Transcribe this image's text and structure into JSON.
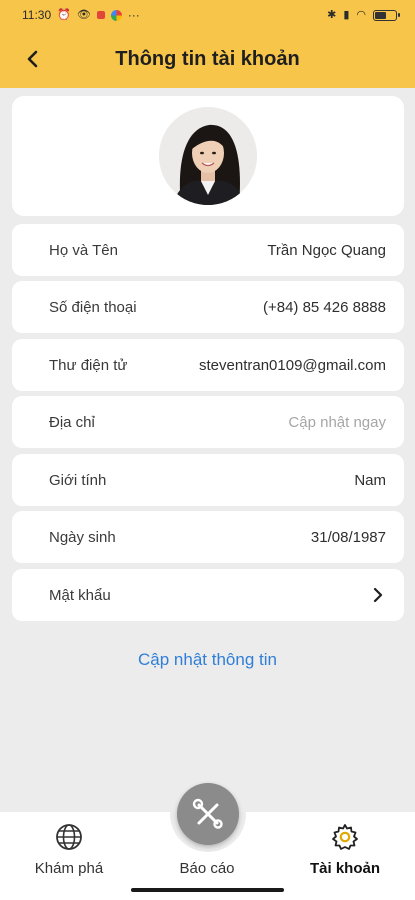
{
  "status_bar": {
    "time": "11:30",
    "dots": "···",
    "battery_level": 0.6
  },
  "header": {
    "title": "Thông tin tài khoản",
    "back_icon": "arrow-left-icon"
  },
  "profile": {
    "avatar_icon": "user-photo"
  },
  "rows": {
    "full_name": {
      "label": "Họ và Tên",
      "value": "Trần Ngọc Quang"
    },
    "phone": {
      "label": "Số điện thoại",
      "value": "(+84) 85 426 8888"
    },
    "email": {
      "label": "Thư điện tử",
      "value": "steventran0109@gmail.com"
    },
    "address": {
      "label": "Địa chỉ",
      "value": "Cập nhật ngay"
    },
    "gender": {
      "label": "Giới tính",
      "value": "Nam"
    },
    "birthday": {
      "label": "Ngày sinh",
      "value": "31/08/1987"
    },
    "password": {
      "label": "Mật khẩu"
    }
  },
  "update_link": "Cập nhật thông tin",
  "nav": {
    "explore": {
      "label": "Khám phá",
      "icon": "globe-icon"
    },
    "report": {
      "label": "Báo cáo",
      "icon": "tools-icon"
    },
    "account": {
      "label": "Tài khoản",
      "icon": "gear-icon",
      "active": true
    }
  },
  "colors": {
    "accent": "#f7c54a",
    "link": "#2f7fd8",
    "background": "#ececec",
    "gear_active": "#e0a800"
  }
}
